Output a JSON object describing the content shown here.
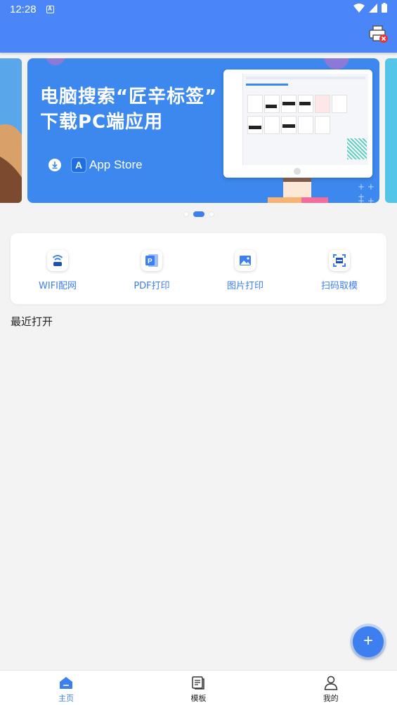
{
  "status_bar": {
    "time": "12:28",
    "notification_icon": "A-icon"
  },
  "header": {
    "printer_icon": "printer-disconnected-icon"
  },
  "banner": {
    "title_line1": "电脑搜索“匠辛标签”",
    "title_line2": "下载PC端应用",
    "store_label": "App Store",
    "active_slide": 2,
    "slide_count": 3
  },
  "quick_actions": [
    {
      "label": "WIFI配网",
      "icon": "wifi-icon"
    },
    {
      "label": "PDF打印",
      "icon": "pdf-icon"
    },
    {
      "label": "图片打印",
      "icon": "image-icon"
    },
    {
      "label": "扫码取模",
      "icon": "scan-icon"
    }
  ],
  "recent": {
    "title": "最近打开"
  },
  "fab": {
    "label": "+"
  },
  "bottom_nav": [
    {
      "label": "主页",
      "icon": "home-icon",
      "active": true
    },
    {
      "label": "模板",
      "icon": "template-icon",
      "active": false
    },
    {
      "label": "我的",
      "icon": "profile-icon",
      "active": false
    }
  ],
  "colors": {
    "primary": "#4a86f7",
    "accent": "#3d7ef0",
    "background": "#f3f3f3"
  }
}
